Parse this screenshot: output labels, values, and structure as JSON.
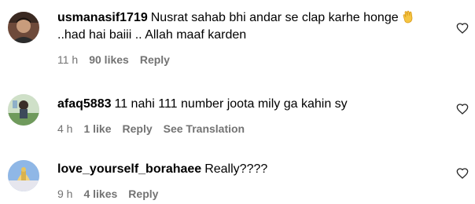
{
  "comments": [
    {
      "username": "usmanasif1719",
      "text_line1": "Nusrat sahab bhi andar se clap karhe honge",
      "emoji": "clapping-hands",
      "text_line2": "..had hai baiii .. Allah maaf karden",
      "time": "11 h",
      "likes": "90 likes",
      "reply": "Reply"
    },
    {
      "username": "afaq5883",
      "text": "11 nahi 111 number joota mily ga kahin sy",
      "time": "4 h",
      "likes": "1 like",
      "reply": "Reply",
      "see_translation": "See Translation"
    },
    {
      "username": "love_yourself_borahaee",
      "text": "Really????",
      "time": "9 h",
      "likes": "4 likes",
      "reply": "Reply"
    }
  ],
  "icons": {
    "like": "heart-outline-icon"
  },
  "colors": {
    "meta": "#737373",
    "text": "#000000"
  }
}
